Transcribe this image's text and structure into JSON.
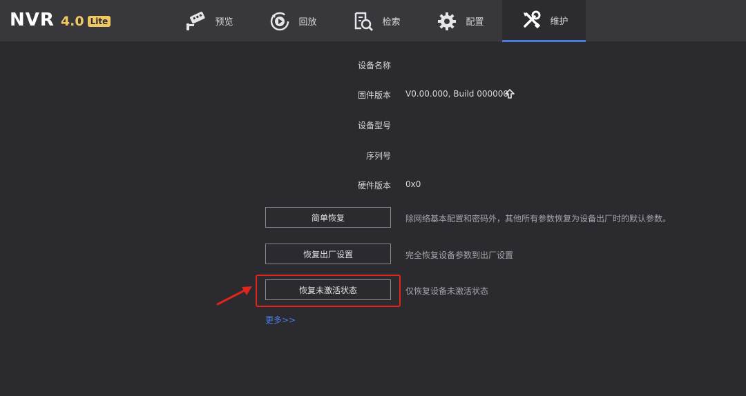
{
  "header": {
    "brand": "NVR",
    "version": "4.0",
    "edition": "Lite"
  },
  "nav": {
    "tabs": [
      {
        "label": "预览",
        "icon": "camera-icon"
      },
      {
        "label": "回放",
        "icon": "playback-icon"
      },
      {
        "label": "检索",
        "icon": "search-file-icon"
      },
      {
        "label": "配置",
        "icon": "gear-icon"
      },
      {
        "label": "维护",
        "icon": "tools-icon",
        "active": true
      }
    ]
  },
  "info": {
    "device_name_label": "设备名称",
    "device_name_value": "",
    "firmware_label": "固件版本",
    "firmware_value": "V0.00.000, Build 000000",
    "model_label": "设备型号",
    "model_value": "",
    "serial_label": "序列号",
    "serial_value": "",
    "hardware_label": "硬件版本",
    "hardware_value": "0x0"
  },
  "actions": {
    "simple_restore_label": "简单恢复",
    "simple_restore_desc": "除网络基本配置和密码外，其他所有参数恢复为设备出厂时的默认参数。",
    "factory_reset_label": "恢复出厂设置",
    "factory_reset_desc": "完全恢复设备参数到出厂设置",
    "deactivate_label": "恢复未激活状态",
    "deactivate_desc": "仅恢复设备未激活状态",
    "more_label": "更多>>"
  },
  "colors": {
    "accent": "#4a7bd6",
    "highlight": "#e0251d",
    "brand_yellow": "#f0c862"
  }
}
